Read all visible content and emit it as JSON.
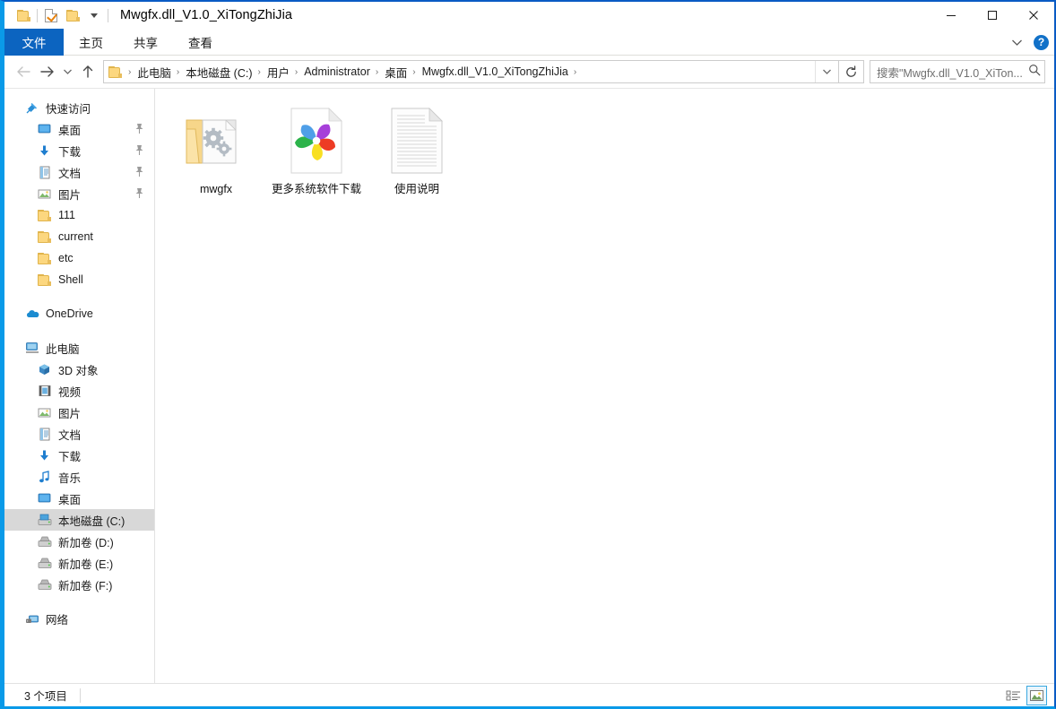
{
  "window": {
    "title": "Mwgfx.dll_V1.0_XiTongZhiJia",
    "accent_color": "#0a9ae8",
    "ribbon_active_color": "#0c64c0"
  },
  "quick_access_toolbar": {
    "items": [
      {
        "name": "folder-icon",
        "tooltip": "文件资源管理器"
      },
      {
        "name": "properties-icon",
        "tooltip": "属性"
      },
      {
        "name": "new-folder-icon",
        "tooltip": "新建文件夹"
      },
      {
        "name": "customize-dropdown-icon",
        "tooltip": "自定义快速访问工具栏"
      }
    ]
  },
  "window_controls": {
    "minimize": "—",
    "maximize": "□",
    "close": "✕"
  },
  "ribbon": {
    "tabs": [
      {
        "label": "文件",
        "active": true
      },
      {
        "label": "主页",
        "active": false
      },
      {
        "label": "共享",
        "active": false
      },
      {
        "label": "查看",
        "active": false
      }
    ],
    "expand_icon": "chevron-down-icon",
    "help_label": "?"
  },
  "toolbar": {
    "back_icon": "back-arrow-icon",
    "forward_icon": "forward-arrow-icon",
    "recent_icon": "recent-locations-chevron-icon",
    "up_icon": "up-arrow-icon",
    "address_dropdown_icon": "chevron-down-icon",
    "refresh_icon": "refresh-icon"
  },
  "address_bar": {
    "crumbs": [
      "此电脑",
      "本地磁盘 (C:)",
      "用户",
      "Administrator",
      "桌面",
      "Mwgfx.dll_V1.0_XiTongZhiJia"
    ],
    "separator": "›"
  },
  "search": {
    "value": "搜索\"Mwgfx.dll_V1.0_XiTon...",
    "placeholder": "搜索\"Mwgfx.dll_V1.0_XiTon...",
    "icon": "search-icon"
  },
  "sidebar": {
    "groups": [
      {
        "header": {
          "label": "快速访问",
          "icon": "pin-star-icon"
        },
        "items": [
          {
            "label": "桌面",
            "icon": "desktop-icon",
            "pinned": true,
            "indent": 1
          },
          {
            "label": "下载",
            "icon": "downloads-icon",
            "pinned": true,
            "indent": 1
          },
          {
            "label": "文档",
            "icon": "documents-icon",
            "pinned": true,
            "indent": 1
          },
          {
            "label": "图片",
            "icon": "pictures-icon",
            "pinned": true,
            "indent": 1
          },
          {
            "label": "111",
            "icon": "folder-icon",
            "pinned": false,
            "indent": 1
          },
          {
            "label": "current",
            "icon": "folder-icon",
            "pinned": false,
            "indent": 1
          },
          {
            "label": "etc",
            "icon": "folder-icon",
            "pinned": false,
            "indent": 1
          },
          {
            "label": "Shell",
            "icon": "folder-icon",
            "pinned": false,
            "indent": 1
          }
        ]
      },
      {
        "header": {
          "label": "OneDrive",
          "icon": "onedrive-cloud-icon"
        },
        "items": []
      },
      {
        "header": {
          "label": "此电脑",
          "icon": "this-pc-icon"
        },
        "items": [
          {
            "label": "3D 对象",
            "icon": "3d-objects-icon",
            "pinned": false,
            "indent": 1
          },
          {
            "label": "视频",
            "icon": "videos-icon",
            "pinned": false,
            "indent": 1
          },
          {
            "label": "图片",
            "icon": "pictures-icon",
            "pinned": false,
            "indent": 1
          },
          {
            "label": "文档",
            "icon": "documents-icon",
            "pinned": false,
            "indent": 1
          },
          {
            "label": "下载",
            "icon": "downloads-icon",
            "pinned": false,
            "indent": 1
          },
          {
            "label": "音乐",
            "icon": "music-icon",
            "pinned": false,
            "indent": 1
          },
          {
            "label": "桌面",
            "icon": "desktop-icon",
            "pinned": false,
            "indent": 1
          },
          {
            "label": "本地磁盘 (C:)",
            "icon": "system-drive-icon",
            "pinned": false,
            "indent": 1,
            "selected": true
          },
          {
            "label": "新加卷 (D:)",
            "icon": "drive-icon",
            "pinned": false,
            "indent": 1
          },
          {
            "label": "新加卷 (E:)",
            "icon": "drive-icon",
            "pinned": false,
            "indent": 1
          },
          {
            "label": "新加卷 (F:)",
            "icon": "drive-icon",
            "pinned": false,
            "indent": 1
          }
        ]
      },
      {
        "header": {
          "label": "网络",
          "icon": "network-icon"
        },
        "items": []
      }
    ]
  },
  "files": [
    {
      "name": "mwgfx",
      "icon": "folder-with-dll-icon",
      "type": "folder"
    },
    {
      "name": "更多系统软件下载",
      "icon": "pinwheel-shortcut-icon",
      "type": "internet-shortcut"
    },
    {
      "name": "使用说明",
      "icon": "text-document-icon",
      "type": "text-document"
    }
  ],
  "status_bar": {
    "item_count": "3 个项目",
    "view_details_icon": "details-view-icon",
    "view_large_icons_icon": "large-icons-view-icon",
    "active_view": "large-icons"
  }
}
